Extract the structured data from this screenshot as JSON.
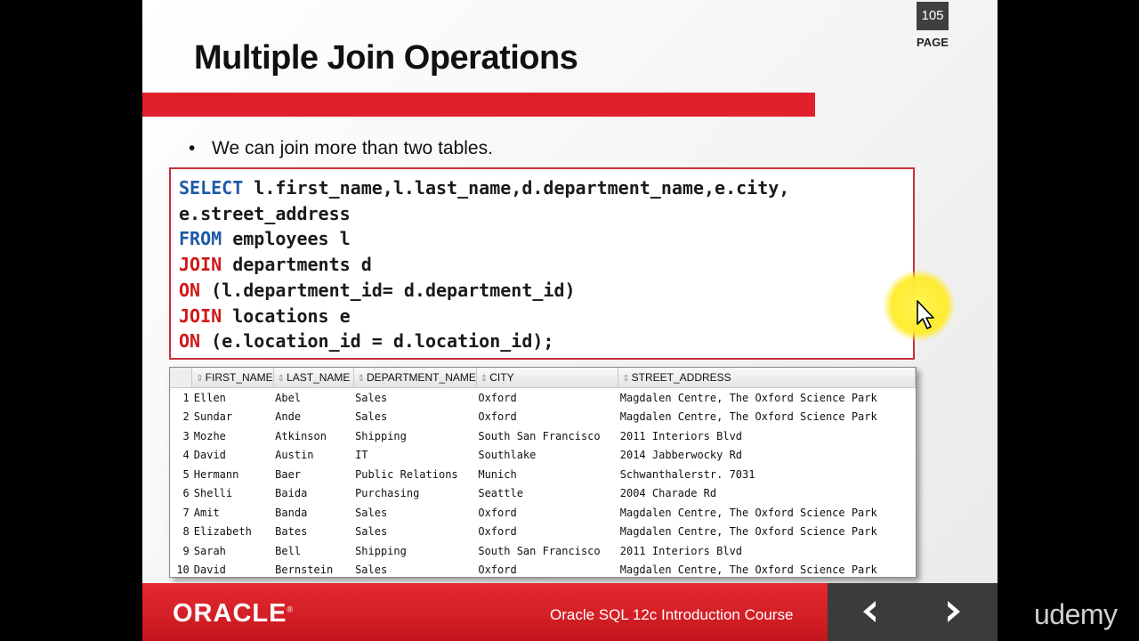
{
  "page": {
    "number": "105",
    "label": "PAGE"
  },
  "slide": {
    "title": "Multiple Join Operations",
    "bullet": "We can join more than two tables."
  },
  "code": {
    "line1_kw": "SELECT",
    "line1_rest": " l.first_name,l.last_name,d.department_name,e.city,",
    "line2": "e.street_address",
    "line3_kw": "FROM",
    "line3_rest": " employees l",
    "line4_kw": "JOIN",
    "line4_rest": " departments d",
    "line5_kw": "ON",
    "line5_rest": " (l.department_id= d.department_id)",
    "line6_kw": "JOIN",
    "line6_rest": " locations e",
    "line7_kw": "ON",
    "line7_rest": " (e.location_id = d.location_id);"
  },
  "result": {
    "columns": [
      "FIRST_NAME",
      "LAST_NAME",
      "DEPARTMENT_NAME",
      "CITY",
      "STREET_ADDRESS"
    ],
    "rows": [
      [
        "1",
        "Ellen",
        "Abel",
        "Sales",
        "Oxford",
        "Magdalen Centre, The Oxford Science Park"
      ],
      [
        "2",
        "Sundar",
        "Ande",
        "Sales",
        "Oxford",
        "Magdalen Centre, The Oxford Science Park"
      ],
      [
        "3",
        "Mozhe",
        "Atkinson",
        "Shipping",
        "South San Francisco",
        "2011 Interiors Blvd"
      ],
      [
        "4",
        "David",
        "Austin",
        "IT",
        "Southlake",
        "2014 Jabberwocky Rd"
      ],
      [
        "5",
        "Hermann",
        "Baer",
        "Public Relations",
        "Munich",
        "Schwanthalerstr. 7031"
      ],
      [
        "6",
        "Shelli",
        "Baida",
        "Purchasing",
        "Seattle",
        "2004 Charade Rd"
      ],
      [
        "7",
        "Amit",
        "Banda",
        "Sales",
        "Oxford",
        "Magdalen Centre, The Oxford Science Park"
      ],
      [
        "8",
        "Elizabeth",
        "Bates",
        "Sales",
        "Oxford",
        "Magdalen Centre, The Oxford Science Park"
      ],
      [
        "9",
        "Sarah",
        "Bell",
        "Shipping",
        "South San Francisco",
        "2011 Interiors Blvd"
      ],
      [
        "10",
        "David",
        "Bernstein",
        "Sales",
        "Oxford",
        "Magdalen Centre, The Oxford Science Park"
      ]
    ]
  },
  "footer": {
    "logo": "ORACLE",
    "logo_mark": "®",
    "course": "Oracle SQL 12c Introduction Course",
    "prev_icon": "chevron-left-icon",
    "next_icon": "chevron-right-icon"
  },
  "watermark": "udemy",
  "colors": {
    "accent_red": "#e0202a",
    "keyword_blue": "#1d5aa8",
    "keyword_red": "#d01818",
    "nav_bg": "#3b3b3b"
  }
}
